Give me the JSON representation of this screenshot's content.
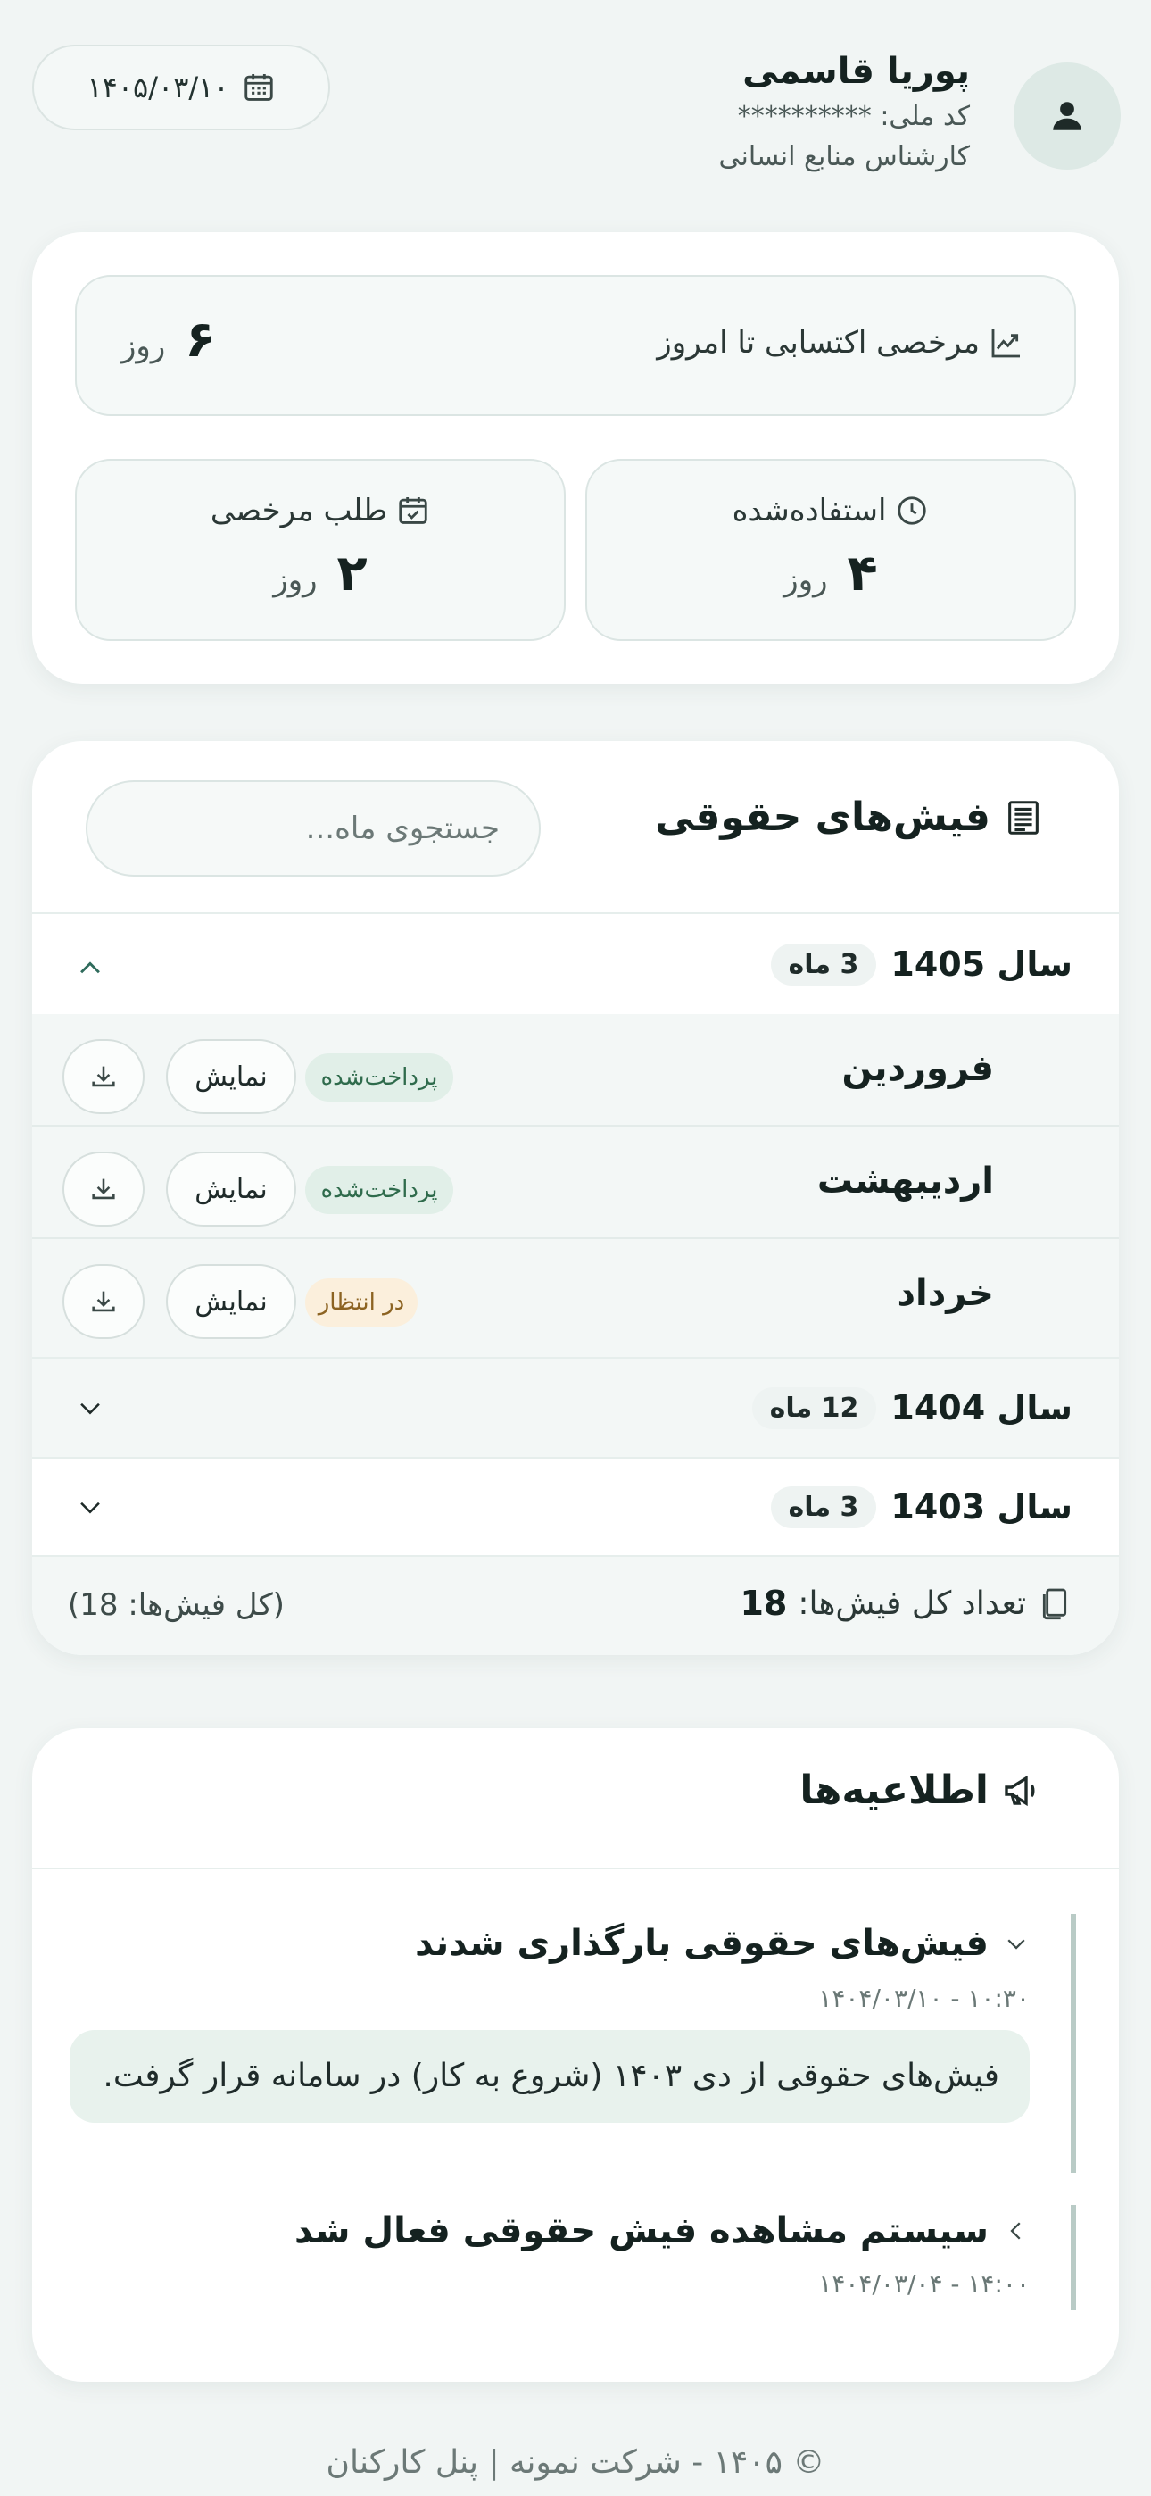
{
  "user": {
    "name": "پوریا قاسمی",
    "national_id": "کد ملی: **********",
    "role": "کارشناس منابع انسانی",
    "avatar_icon": "user-icon"
  },
  "date": {
    "value": "۱۴۰۵/۰۳/۱۰",
    "icon": "calendar-icon"
  },
  "leave": {
    "earned": {
      "title": "مرخصی اکتسابی تا امروز",
      "value": "۶",
      "unit": "روز",
      "icon": "chart-line-icon"
    },
    "used": {
      "title": "استفاده‌شده",
      "value": "۴",
      "unit": "روز",
      "icon": "clock-icon"
    },
    "request": {
      "title": "طلب مرخصی",
      "value": "۲",
      "unit": "روز",
      "icon": "calendar-check-icon"
    }
  },
  "payslips": {
    "title": "فیش‌های حقوقی",
    "icon": "receipt-icon",
    "search_placeholder": "جستجوی ماه...",
    "years": [
      {
        "label": "سال 1405",
        "count": "3 ماه",
        "expanded": true
      },
      {
        "label": "سال 1404",
        "count": "12 ماه",
        "expanded": false
      },
      {
        "label": "سال 1403",
        "count": "3 ماه",
        "expanded": false
      }
    ],
    "months": [
      {
        "name": "فروردین",
        "status": "پرداخت‌شده",
        "status_type": "paid",
        "show_label": "نمایش"
      },
      {
        "name": "اردیبهشت",
        "status": "پرداخت‌شده",
        "status_type": "paid",
        "show_label": "نمایش"
      },
      {
        "name": "خرداد",
        "status": "در انتظار",
        "status_type": "pending",
        "show_label": "نمایش"
      }
    ],
    "total_label": "تعداد کل فیش‌ها:",
    "total_value": "18",
    "total_note": "(کل فیش‌ها: 18)"
  },
  "announcements": {
    "title": "اطلاعیه‌ها",
    "icon": "megaphone-icon",
    "items": [
      {
        "title": "فیش‌های حقوقی بارگذاری شدند",
        "date": "۱۴۰۴/۰۳/۱۰ - ۱۰:۳۰",
        "body": "فیش‌های حقوقی از دی ۱۴۰۳ (شروع به کار) در سامانه قرار گرفت.",
        "expanded": true
      },
      {
        "title": "سیستم مشاهده فیش حقوقی فعال شد",
        "date": "۱۴۰۴/۰۳/۰۴ - ۱۴:۰۰",
        "expanded": false
      }
    ]
  },
  "footer": "© ۱۴۰۵ - شرکت نمونه | پنل کارکنان",
  "colors": {
    "accent": "#2f6b5c",
    "paid_bg": "#e1efe8",
    "pending_bg": "#fbefdc",
    "page_bg": "#f1f5f4"
  }
}
